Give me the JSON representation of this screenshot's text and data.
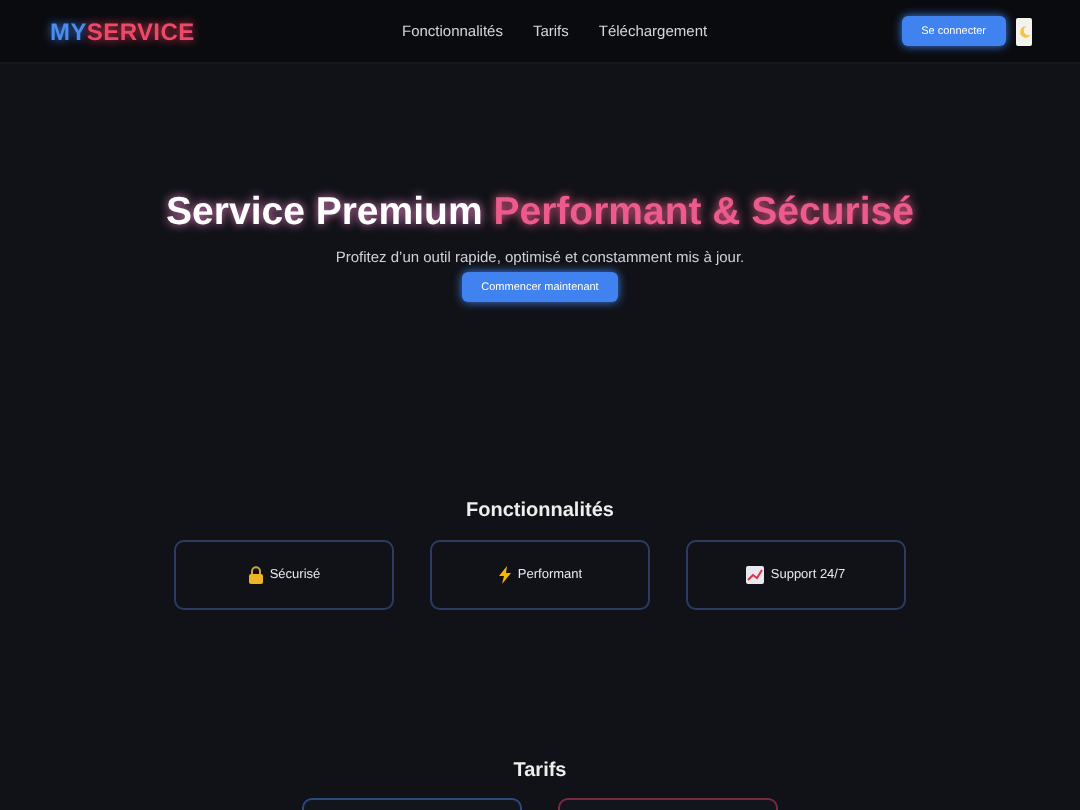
{
  "header": {
    "logo_first": "MY",
    "logo_second": "SERVICE",
    "nav": [
      "Fonctionnalités",
      "Tarifs",
      "Téléchargement"
    ],
    "login_button": "Se connecter"
  },
  "hero": {
    "title": "Service Premium",
    "title_highlight": "Performant & Sécurisé",
    "subtitle": "Profitez d’un outil rapide, optimisé et constamment mis à jour.",
    "cta_button": "Commencer maintenant"
  },
  "features": {
    "heading": "Fonctionnalités",
    "items": [
      {
        "kind": "lock",
        "label": "Sécurisé"
      },
      {
        "kind": "bolt",
        "label": "Performant"
      },
      {
        "kind": "chart",
        "label": "Support 24/7"
      }
    ]
  },
  "pricing": {
    "heading": "Tarifs",
    "cards": [
      {
        "color": "#2a4a7a"
      },
      {
        "color": "#7a2a40"
      }
    ]
  }
}
